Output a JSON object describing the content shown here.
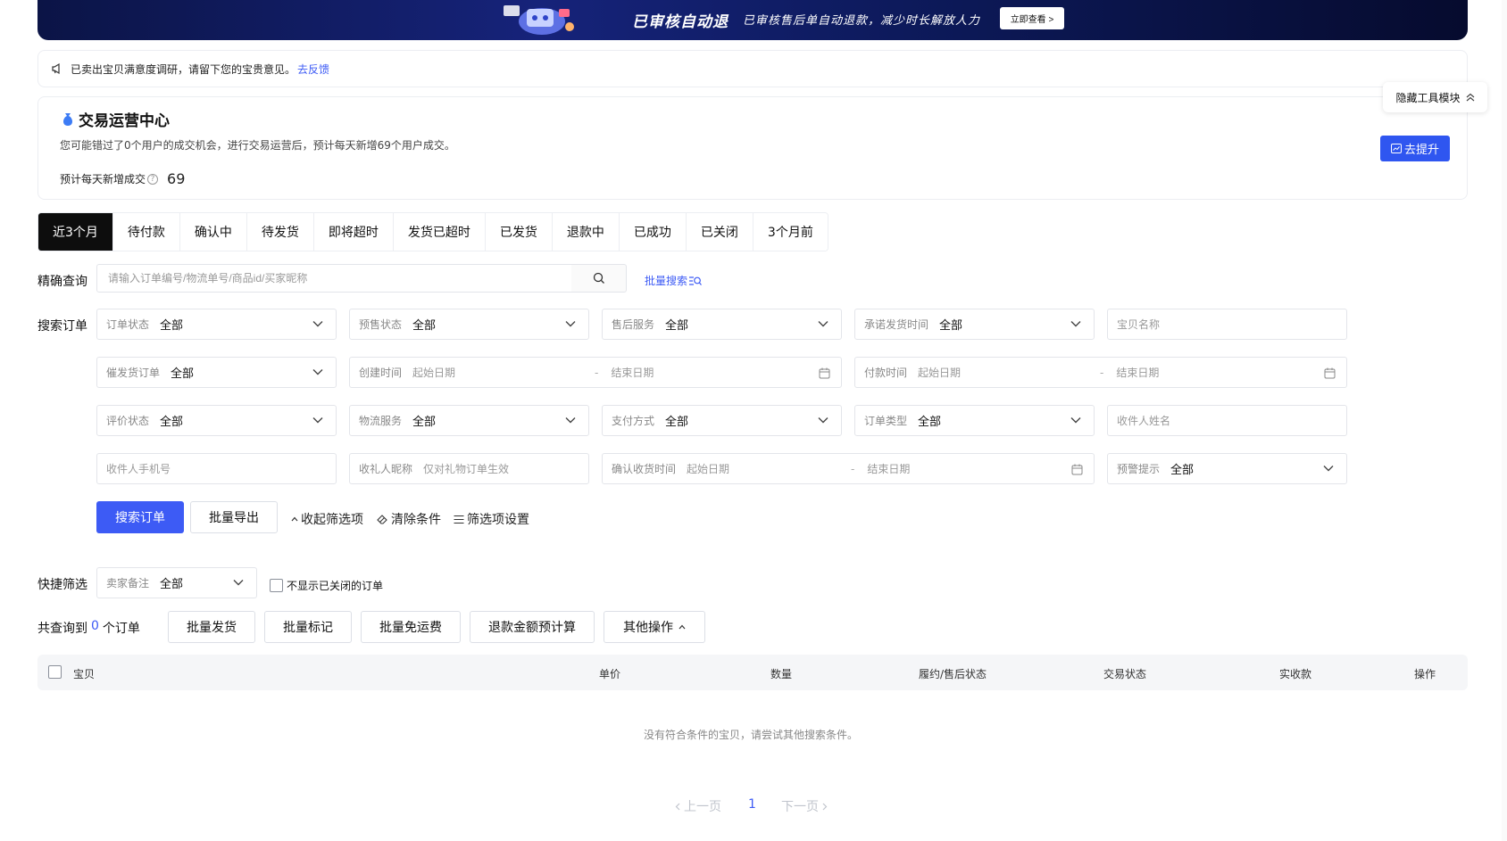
{
  "banner": {
    "title": "已审核自动退",
    "subtitle": "已审核售后单自动退款，减少时长解放人力",
    "button": "立即查看 >"
  },
  "notice": {
    "text": "已卖出宝贝满意度调研，请留下您的宝贵意见。",
    "link": "去反馈"
  },
  "ops_center": {
    "title": "交易运营中心",
    "description": "您可能错过了0个用户的成交机会，进行交易运营后，预计每天新增69个用户成交。",
    "stat_label": "预计每天新增成交",
    "stat_value": "69",
    "button": "去提升"
  },
  "hide_tool": {
    "label": "隐藏工具模块"
  },
  "tabs": [
    {
      "label": "近3个月",
      "active": true
    },
    {
      "label": "待付款"
    },
    {
      "label": "确认中"
    },
    {
      "label": "待发货"
    },
    {
      "label": "即将超时"
    },
    {
      "label": "发货已超时"
    },
    {
      "label": "已发货"
    },
    {
      "label": "退款中"
    },
    {
      "label": "已成功"
    },
    {
      "label": "已关闭"
    },
    {
      "label": "3个月前"
    }
  ],
  "precise": {
    "label": "精确查询",
    "placeholder": "请输入订单编号/物流单号/商品id/买家昵称",
    "batch_search": "批量搜索"
  },
  "search": {
    "label": "搜索订单",
    "order_status": {
      "label": "订单状态",
      "value": "全部"
    },
    "presale_status": {
      "label": "预售状态",
      "value": "全部"
    },
    "after_sale": {
      "label": "售后服务",
      "value": "全部"
    },
    "promise_ship_time": {
      "label": "承诺发货时间",
      "value": "全部"
    },
    "item_name": {
      "placeholder": "宝贝名称"
    },
    "urge_ship": {
      "label": "催发货订单",
      "value": "全部"
    },
    "create_time": {
      "label": "创建时间",
      "start": "起始日期",
      "end": "结束日期"
    },
    "pay_time": {
      "label": "付款时间",
      "start": "起始日期",
      "end": "结束日期"
    },
    "review_status": {
      "label": "评价状态",
      "value": "全部"
    },
    "logistics": {
      "label": "物流服务",
      "value": "全部"
    },
    "pay_method": {
      "label": "支付方式",
      "value": "全部"
    },
    "order_type": {
      "label": "订单类型",
      "value": "全部"
    },
    "receiver_name": {
      "placeholder": "收件人姓名"
    },
    "receiver_phone": {
      "placeholder": "收件人手机号"
    },
    "gift_nick": {
      "label": "收礼人昵称",
      "placeholder": "仅对礼物订单生效"
    },
    "confirm_time": {
      "label": "确认收货时间",
      "start": "起始日期",
      "end": "结束日期"
    },
    "warning": {
      "label": "预警提示",
      "value": "全部"
    }
  },
  "actions": {
    "search": "搜索订单",
    "export": "批量导出",
    "collapse": "收起筛选项",
    "clear": "清除条件",
    "settings": "筛选项设置"
  },
  "quick_filter": {
    "label": "快捷筛选",
    "seller_note": {
      "label": "卖家备注",
      "value": "全部"
    },
    "hide_closed": "不显示已关闭的订单"
  },
  "summary": {
    "prefix": "共查询到",
    "count": "0",
    "suffix": "个订单"
  },
  "batch": {
    "ship": "批量发货",
    "mark": "批量标记",
    "free_ship": "批量免运费",
    "refund_calc": "退款金额预计算",
    "other": "其他操作"
  },
  "table": {
    "columns": [
      "宝贝",
      "单价",
      "数量",
      "履约/售后状态",
      "交易状态",
      "实收款",
      "操作"
    ],
    "empty": "没有符合条件的宝贝，请尝试其他搜索条件。"
  },
  "pagination": {
    "prev": "上一页",
    "current": "1",
    "next": "下一页"
  },
  "colors": {
    "primary": "#3d5bf5",
    "tab_active_bg": "#0d0d0d",
    "border": "#e3e5ea"
  }
}
